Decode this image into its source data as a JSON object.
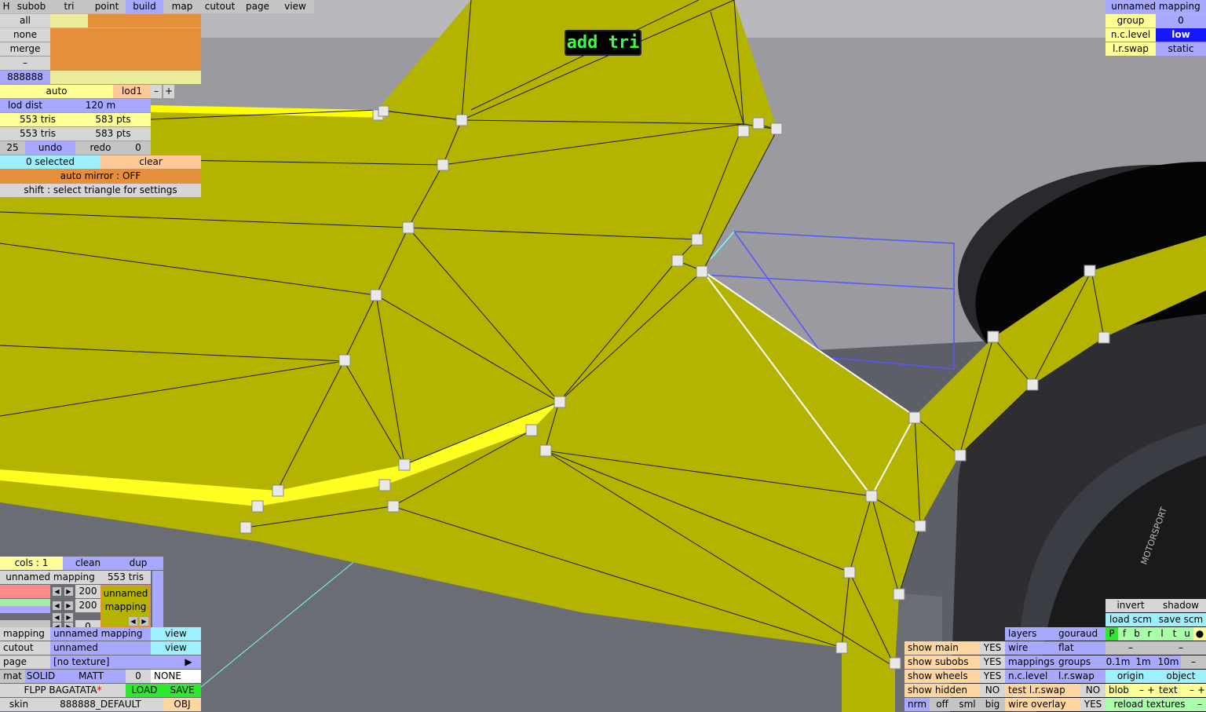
{
  "canvas": {
    "overlay_label": "add tri"
  },
  "top_tabs": [
    "H",
    "subob",
    "tri",
    "point",
    "build",
    "map",
    "cutout",
    "page",
    "view"
  ],
  "active_tab": "build",
  "subob_panel": {
    "rows": [
      "all",
      "none",
      "merge",
      "–"
    ],
    "id_label": "888888"
  },
  "lod_panel": {
    "auto": "auto",
    "lod": "lod1",
    "minus": "–",
    "plus": "+",
    "lod_dist_label": "lod dist",
    "lod_dist_value": "120 m",
    "tris_a": "553 tris",
    "pts_a": "583 pts",
    "tris_b": "553 tris",
    "pts_b": "583 pts",
    "undo_count": "25",
    "undo": "undo",
    "redo": "redo",
    "redo_count": "0",
    "selected": "0 selected",
    "clear": "clear",
    "auto_mirror": "auto mirror : OFF",
    "hint": "shift : select triangle for settings"
  },
  "top_right": {
    "mapping_title": "unnamed mapping",
    "group_label": "group",
    "group_value": "0",
    "nc_label": "n.c.level",
    "nc_value": "low",
    "lr_label": "l.r.swap",
    "lr_value": "static"
  },
  "bottom_left": {
    "cols": "cols : 1",
    "clean": "clean",
    "dup": "dup",
    "mapping_name": "unnamed mapping",
    "mapping_tris": "553 tris",
    "slider_a_value": "200",
    "slider_b_value": "200",
    "slider_c_value": "0",
    "preview_text": "unnamed mapping",
    "mapping_label": "mapping",
    "mapping_value": "unnamed mapping",
    "mapping_view": "view",
    "cutout_label": "cutout",
    "cutout_value": "unnamed",
    "cutout_view": "view",
    "page_label": "page",
    "page_value": "[no texture]",
    "page_arrow": "▶",
    "mat_label": "mat",
    "mat_solid": "SOLID",
    "mat_matt": "MATT",
    "mat_num": "0",
    "mat_none": "NONE",
    "file_name": "FLPP BAGATATA",
    "file_star": "*",
    "load": "LOAD",
    "save": "SAVE",
    "skin_label": "skin",
    "skin_value": "888888_DEFAULT",
    "obj": "OBJ"
  },
  "bottom_mid": {
    "show_main": "show main",
    "show_main_v": "YES",
    "show_subobs": "show subobs",
    "show_subobs_v": "YES",
    "show_wheels": "show wheels",
    "show_wheels_v": "YES",
    "show_hidden": "show hidden",
    "show_hidden_v": "NO",
    "nrm": "nrm",
    "off": "off",
    "sml": "sml",
    "big": "big",
    "layers": "layers",
    "gouraud": "gouraud",
    "wire": "wire",
    "flat": "flat",
    "mappings": "mappings",
    "groups": "groups",
    "nclevel": "n.c.level",
    "lrswap": "l.r.swap",
    "test_lr": "test l.r.swap",
    "test_lr_v": "NO",
    "wire_overlay": "wire overlay",
    "wire_overlay_v": "YES"
  },
  "bottom_right": {
    "invert": "invert",
    "shadow": "shadow",
    "load_scm": "load scm",
    "save_scm": "save scm",
    "flags": [
      "P",
      "f",
      "b",
      "r",
      "l",
      "t",
      "u",
      "●"
    ],
    "dash1": "–",
    "dash2": "–",
    "dist": [
      "0.1m",
      "1m",
      "10m",
      "–"
    ],
    "origin": "origin",
    "object": "object",
    "blob": "blob",
    "blob_minus": "–",
    "blob_plus": "+",
    "text": "text",
    "text_minus": "–",
    "text_plus": "+",
    "reload": "reload textures",
    "reload_minus": "–"
  },
  "colors": {
    "mesh_fill": "#b4b400",
    "mesh_edge": "#1a1a00",
    "highlight_edge": "#ffffff",
    "accent_strip": "#ffff00",
    "ground": "#5a5d66",
    "wall": "#9a9a9e"
  }
}
